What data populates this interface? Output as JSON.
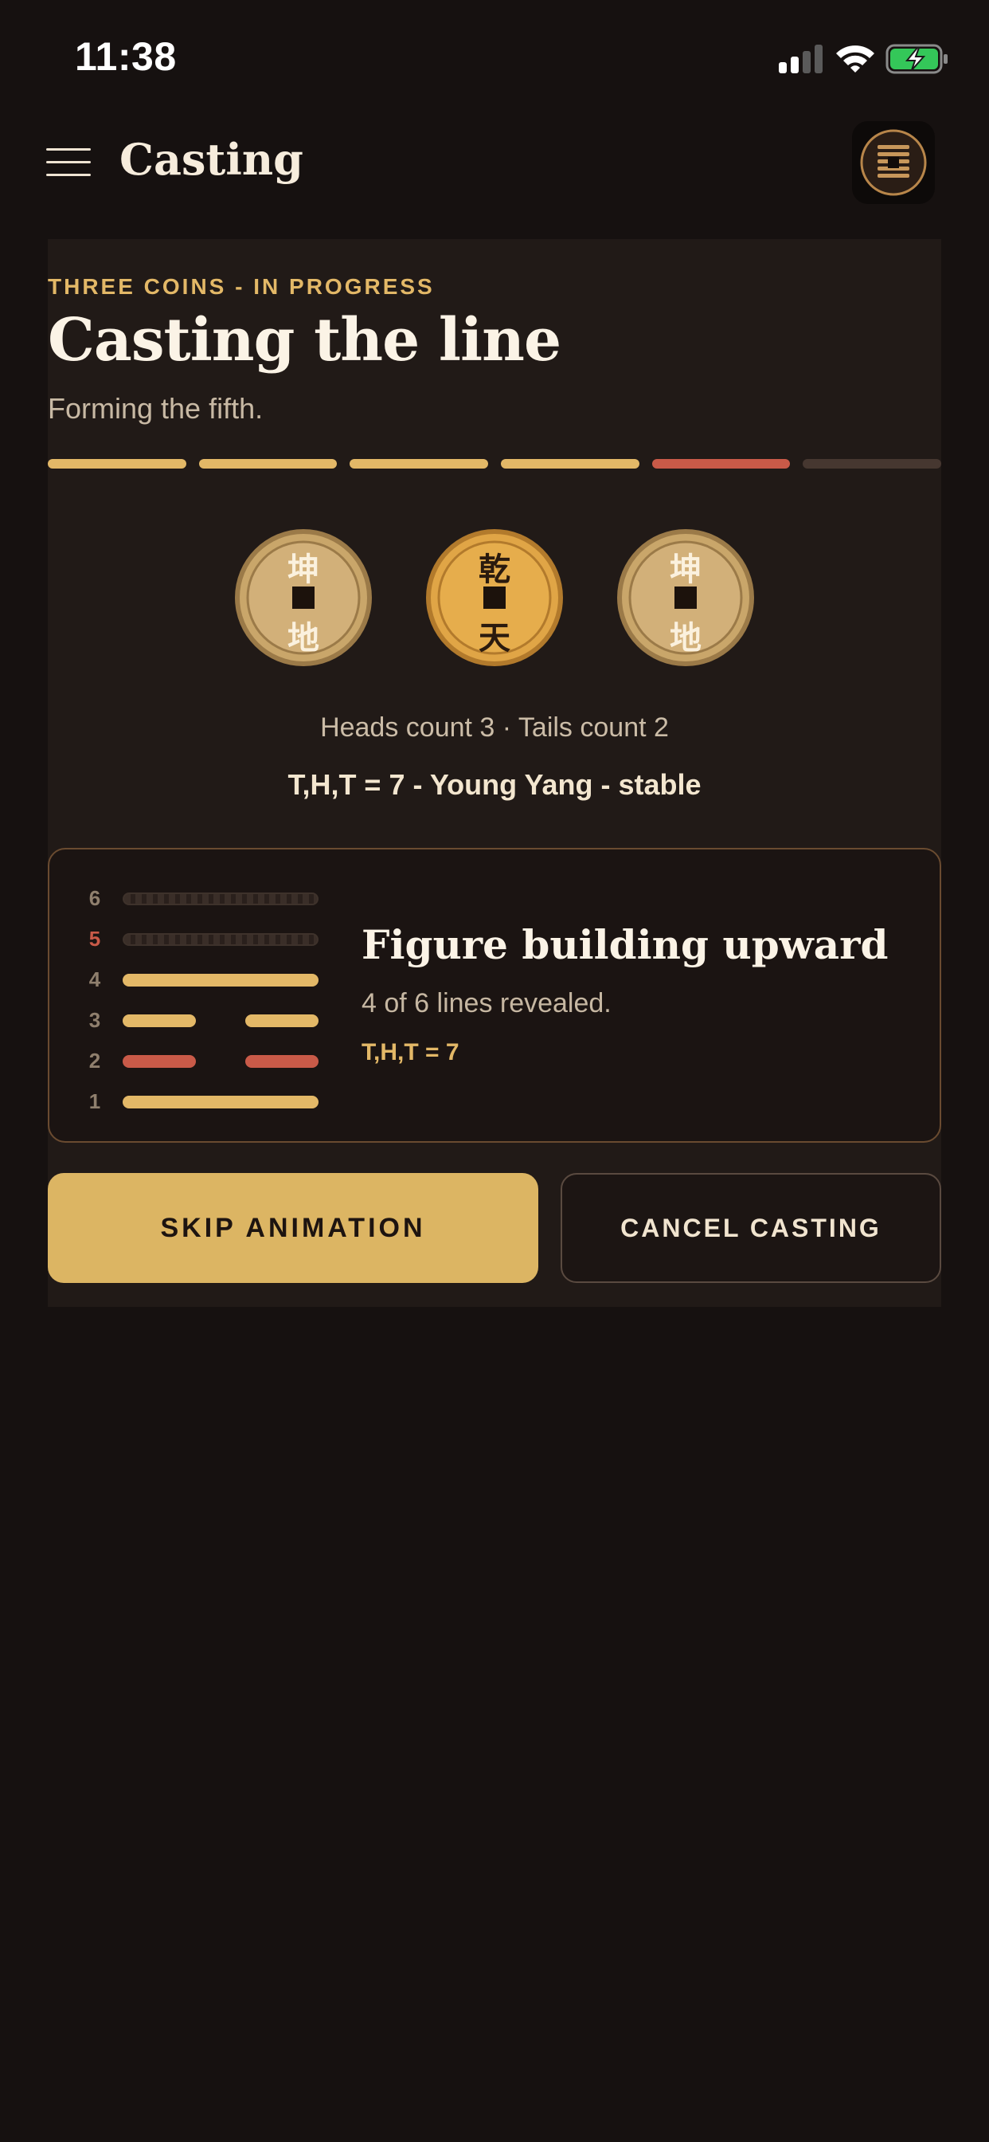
{
  "status": {
    "time": "11:38"
  },
  "header": {
    "title": "Casting",
    "menu_icon": "hamburger-menu-icon",
    "logo_icon": "hexagram-logo-icon"
  },
  "cast": {
    "eyebrow": "THREE COINS - IN PROGRESS",
    "title": "Casting the line",
    "subtitle": "Forming the fifth.",
    "progress": {
      "total_segments": 6,
      "completed": 4,
      "current": 5,
      "colors": {
        "completed": "#e3b867",
        "current": "#c95a48",
        "pending": "#463730"
      }
    },
    "coins": [
      {
        "top": "坤",
        "bottom": "地",
        "face": "tails"
      },
      {
        "top": "乾",
        "bottom": "天",
        "face": "heads"
      },
      {
        "top": "坤",
        "bottom": "地",
        "face": "tails"
      }
    ],
    "counts": "Heads count 3 · Tails count 2",
    "result": "T,H,T = 7 - Young Yang - stable"
  },
  "figure": {
    "lines": [
      {
        "num": "6",
        "state": "pending",
        "type": "pending"
      },
      {
        "num": "5",
        "state": "current",
        "type": "pending"
      },
      {
        "num": "4",
        "state": "done",
        "type": "yang",
        "color": "#e3b867"
      },
      {
        "num": "3",
        "state": "done",
        "type": "yin",
        "color": "#e3b867"
      },
      {
        "num": "2",
        "state": "done",
        "type": "yin",
        "color": "#c95a48"
      },
      {
        "num": "1",
        "state": "done",
        "type": "yang",
        "color": "#e3b867"
      }
    ],
    "title": "Figure building upward",
    "subtitle": "4 of 6 lines revealed.",
    "formula": "T,H,T = 7"
  },
  "actions": {
    "skip": "SKIP ANIMATION",
    "cancel": "CANCEL CASTING"
  }
}
